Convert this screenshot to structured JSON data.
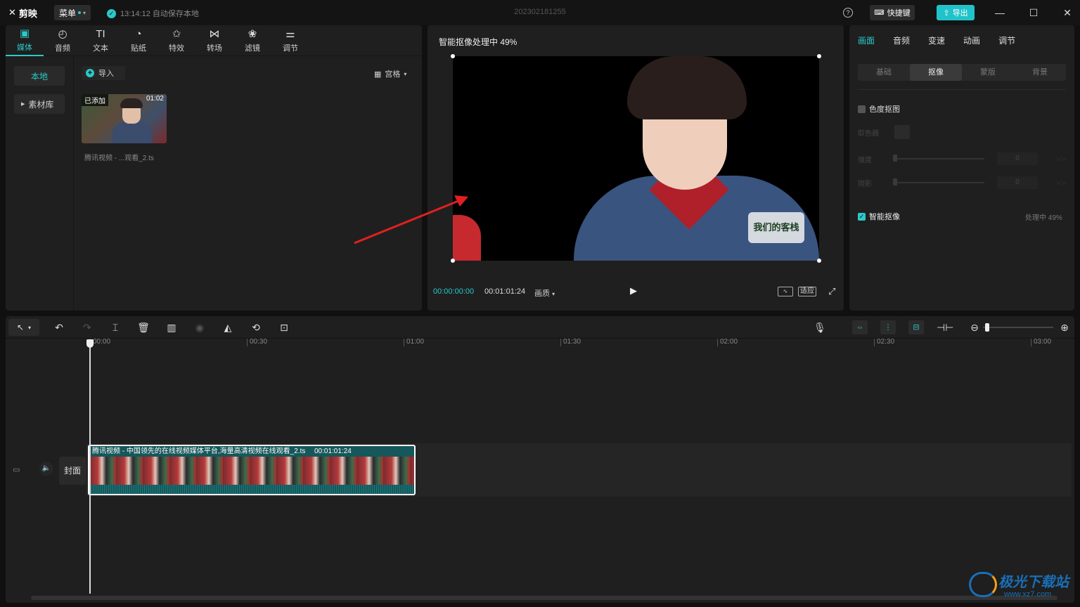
{
  "titlebar": {
    "app_name": "剪映",
    "menu_label": "菜单",
    "autosave_text": "13:14:12 自动保存本地",
    "project_title": "202302181255",
    "shortcut_label": "快捷键",
    "export_label": "导出"
  },
  "media": {
    "tabs": [
      {
        "label": "媒体",
        "icon": "media-icon"
      },
      {
        "label": "音频",
        "icon": "audio-icon"
      },
      {
        "label": "文本",
        "icon": "text-icon"
      },
      {
        "label": "贴纸",
        "icon": "sticker-icon"
      },
      {
        "label": "特效",
        "icon": "effects-icon"
      },
      {
        "label": "转场",
        "icon": "transition-icon"
      },
      {
        "label": "滤镜",
        "icon": "filter-icon"
      },
      {
        "label": "调节",
        "icon": "adjust-icon"
      }
    ],
    "sidebar": {
      "local": "本地",
      "library": "素材库"
    },
    "import_label": "导入",
    "view_label": "宫格",
    "clip": {
      "added_badge": "已添加",
      "duration": "01:02",
      "name": "腾讯视频 - ...观看_2.ts"
    }
  },
  "player": {
    "status": "智能抠像处理中 49%",
    "timecode_current": "00:00:00:00",
    "timecode_total": "00:01:01:24",
    "quality_label": "画质",
    "fit_label": "适应",
    "badge_text": "我们的客栈"
  },
  "inspector": {
    "tabs": [
      "画面",
      "音频",
      "变速",
      "动画",
      "调节"
    ],
    "subtabs": [
      "基础",
      "抠像",
      "蒙版",
      "背景"
    ],
    "chroma_label": "色度抠图",
    "picker_label": "取色器",
    "intensity_label": "强度",
    "shadow_label": "阴影",
    "intensity_value": "0",
    "shadow_value": "0",
    "ai_matting_label": "智能抠像",
    "ai_status": "处理中 49%"
  },
  "timeline": {
    "ticks": [
      "00:00",
      "00:30",
      "01:00",
      "01:30",
      "02:00",
      "02:30",
      "03:00"
    ],
    "cover_label": "封面",
    "clip_label": "腾讯视频 - 中国领先的在线视频媒体平台,海量高清视频在线观看_2.ts",
    "clip_duration": "00:01:01:24"
  },
  "watermark": {
    "text": "极光下载站",
    "url": "www.xz7.com"
  },
  "colors": {
    "accent": "#2bc9c9",
    "clip": "#15575a",
    "arrow": "#e02020"
  }
}
